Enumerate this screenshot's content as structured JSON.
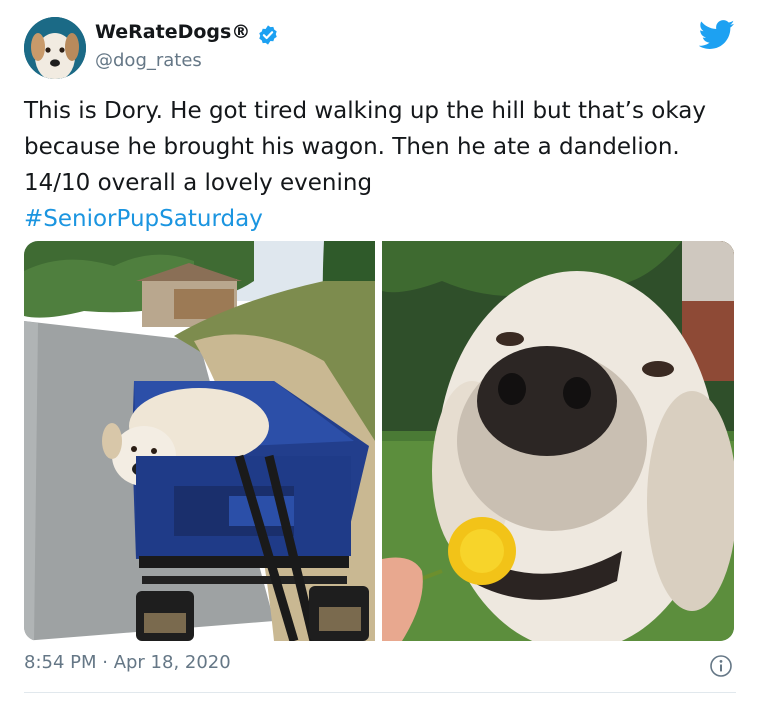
{
  "user": {
    "display_name": "WeRateDogs®",
    "handle": "@dog_rates",
    "avatar_icon": "dog-avatar",
    "verified_icon": "verified-badge-icon"
  },
  "brand": {
    "logo_icon": "twitter-bird-icon",
    "accent_color": "#1da1f2",
    "link_color": "#1b95e0"
  },
  "tweet": {
    "text": "This is Dory. He got tired walking up the hill but that’s okay because he brought his wagon. Then he ate a dandelion. 14/10 overall a lovely evening",
    "hashtag": "#SeniorPupSaturday"
  },
  "media": {
    "photos": [
      {
        "subject": "dog-in-blue-wagon"
      },
      {
        "subject": "dog-eating-dandelion"
      }
    ]
  },
  "meta": {
    "timestamp": "8:54 PM · Apr 18, 2020",
    "info_icon": "info-icon"
  }
}
